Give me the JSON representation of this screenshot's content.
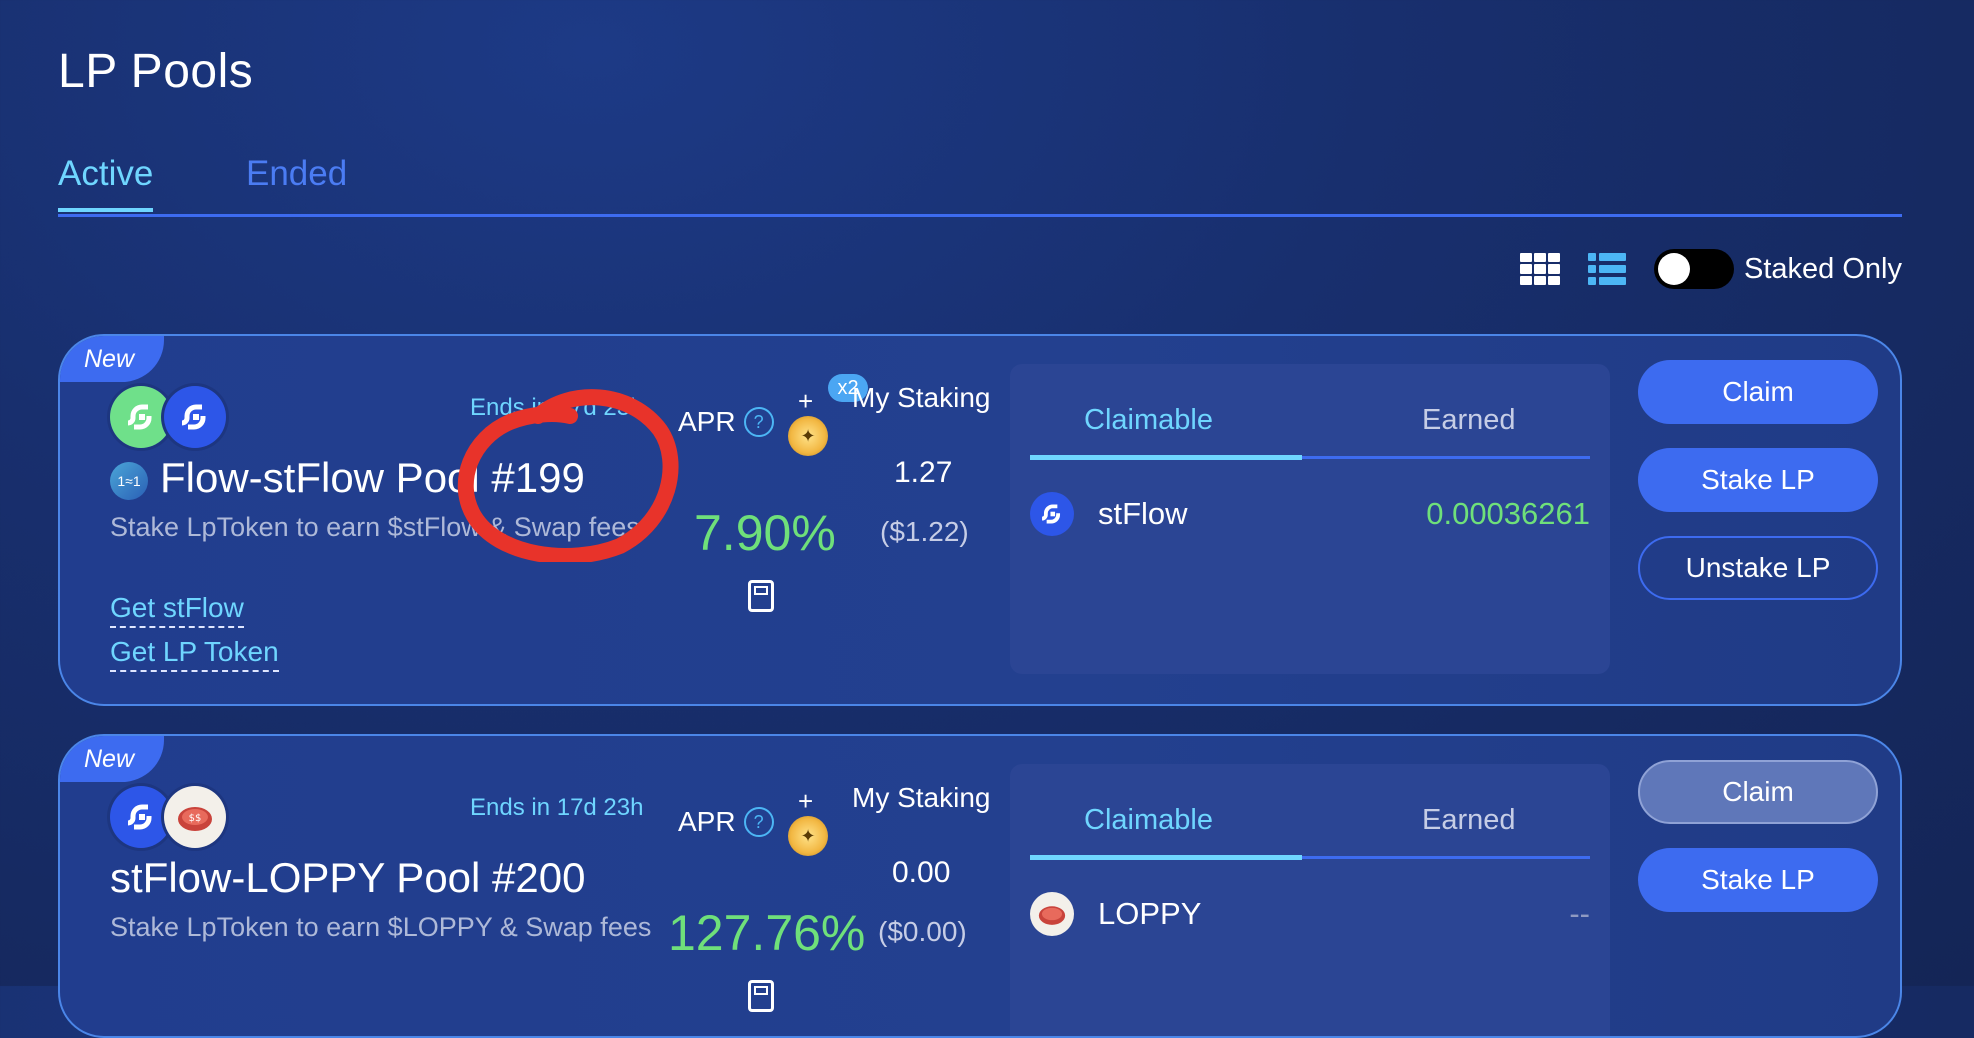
{
  "page": {
    "title": "LP Pools"
  },
  "tabs": [
    {
      "label": "Active"
    },
    {
      "label": "Ended"
    }
  ],
  "view": {
    "staked_only_label": "Staked Only",
    "staked_only_on": false
  },
  "pools": [
    {
      "badge": "New",
      "ends": "Ends in 17d 23h",
      "ratio_badge": "1≈1",
      "title": "Flow-stFlow Pool #199",
      "description": "Stake LpToken to earn $stFlow & Swap fees",
      "links": [
        "Get stFlow",
        "Get LP Token"
      ],
      "apr_label": "APR",
      "apr_help": "?",
      "boost_plus": "+",
      "boost_multiplier": "x2",
      "apr_value": "7.90%",
      "my_staking_label": "My Staking",
      "my_staking_amount": "1.27",
      "my_staking_usd": "($1.22)",
      "claim_tabs": [
        "Claimable",
        "Earned"
      ],
      "reward_token": "stFlow",
      "reward_value": "0.00036261",
      "buttons": {
        "claim": "Claim",
        "stake": "Stake LP",
        "unstake": "Unstake LP"
      }
    },
    {
      "badge": "New",
      "ends": "Ends in 17d 23h",
      "title": "stFlow-LOPPY Pool #200",
      "description": "Stake LpToken to earn $LOPPY & Swap fees",
      "apr_label": "APR",
      "apr_help": "?",
      "boost_plus": "+",
      "apr_value": "127.76%",
      "my_staking_label": "My Staking",
      "my_staking_amount": "0.00",
      "my_staking_usd": "($0.00)",
      "claim_tabs": [
        "Claimable",
        "Earned"
      ],
      "reward_token": "LOPPY",
      "reward_value": "--",
      "buttons": {
        "claim": "Claim",
        "stake": "Stake LP"
      }
    }
  ],
  "colors": {
    "accent": "#3d6bf0",
    "cyan": "#6fd6ff",
    "green": "#6fe07a",
    "annotation": "#e8332a"
  }
}
